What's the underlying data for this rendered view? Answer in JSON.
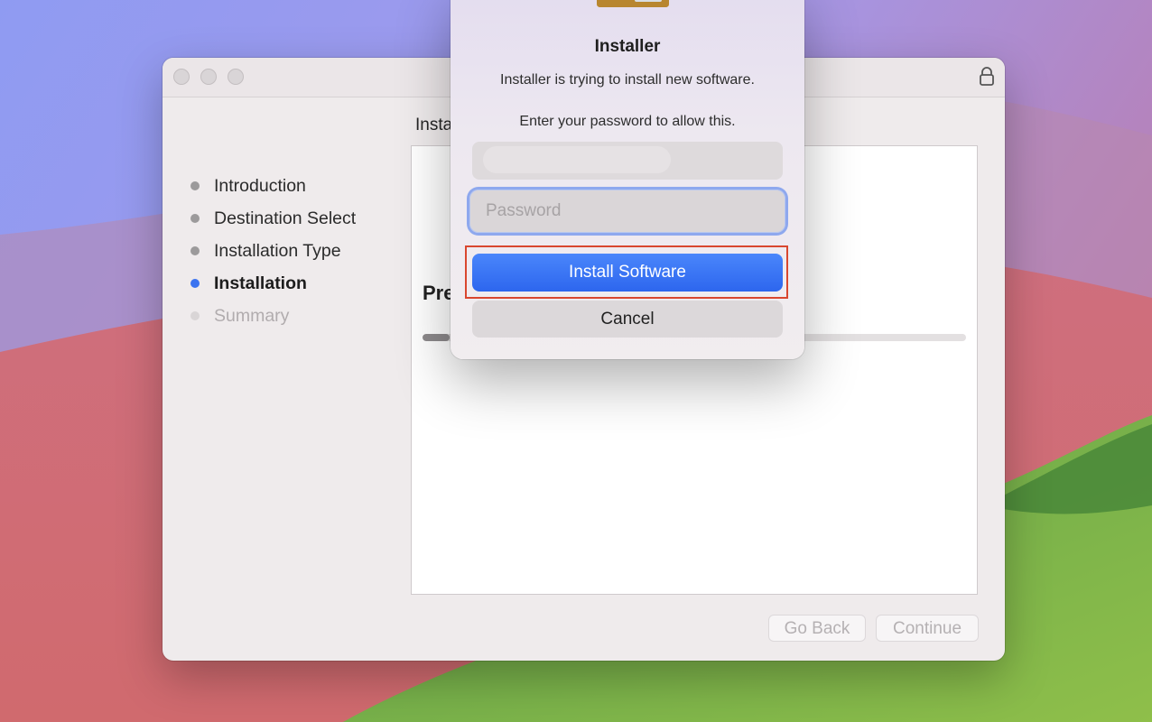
{
  "installer_window": {
    "pane_title": "Insta",
    "steps": [
      {
        "label": "Introduction",
        "state": "done"
      },
      {
        "label": "Destination Select",
        "state": "done"
      },
      {
        "label": "Installation Type",
        "state": "done"
      },
      {
        "label": "Installation",
        "state": "active"
      },
      {
        "label": "Summary",
        "state": "future"
      }
    ],
    "content_heading": "Pre",
    "progress_fraction": 0.05,
    "go_back_label": "Go Back",
    "continue_label": "Continue"
  },
  "auth_dialog": {
    "title": "Installer",
    "message": "Installer is trying to install new software.",
    "prompt": "Enter your password to allow this.",
    "password_placeholder": "Password",
    "install_label": "Install Software",
    "cancel_label": "Cancel"
  },
  "colors": {
    "accent": "#3a73f0",
    "highlight_box": "#d9472f"
  }
}
